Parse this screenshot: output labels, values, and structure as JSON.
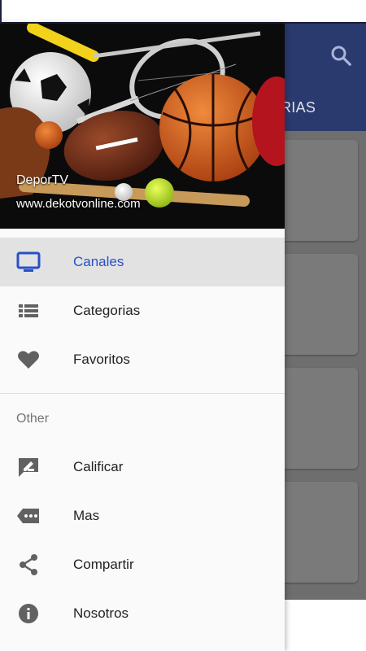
{
  "app": {
    "tab_fragment": "RIAS"
  },
  "header": {
    "title": "DeporTV",
    "url": "www.dekotvonline.com"
  },
  "menu": {
    "primary": [
      {
        "label": "Canales",
        "icon": "tv-icon",
        "active": true
      },
      {
        "label": "Categorias",
        "icon": "list-icon",
        "active": false
      },
      {
        "label": "Favoritos",
        "icon": "heart-icon",
        "active": false
      }
    ],
    "section_title": "Other",
    "secondary": [
      {
        "label": "Calificar",
        "icon": "rate-review-icon"
      },
      {
        "label": "Mas",
        "icon": "more-label-icon"
      },
      {
        "label": "Compartir",
        "icon": "share-icon"
      },
      {
        "label": "Nosotros",
        "icon": "info-icon"
      }
    ]
  },
  "colors": {
    "accent": "#2850c8",
    "icon_gray": "#616161",
    "app_bar": "#2a3a6e"
  }
}
